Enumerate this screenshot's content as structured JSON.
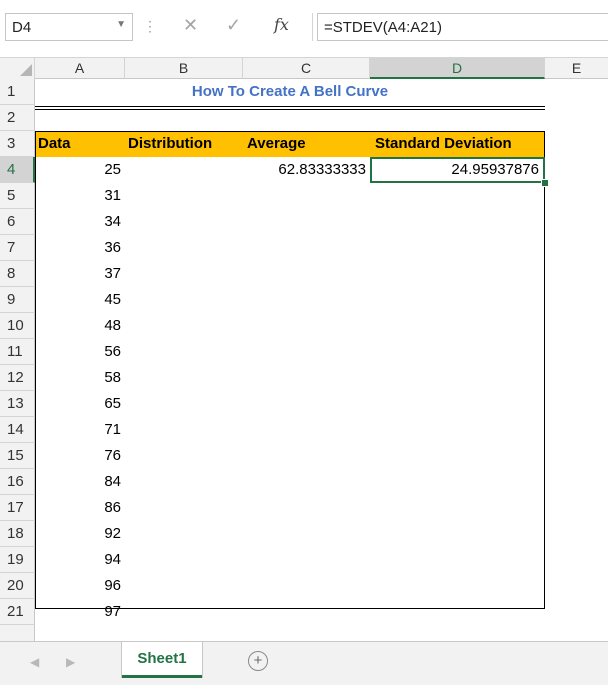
{
  "formula_bar": {
    "name_box": "D4",
    "fx_label": "fx",
    "formula": "=STDEV(A4:A21)"
  },
  "columns": [
    "A",
    "B",
    "C",
    "D",
    "E"
  ],
  "rows": [
    "1",
    "2",
    "3",
    "4",
    "5",
    "6",
    "7",
    "8",
    "9",
    "10",
    "11",
    "12",
    "13",
    "14",
    "15",
    "16",
    "17",
    "18",
    "19",
    "20",
    "21"
  ],
  "selected_column": "D",
  "selected_row": "4",
  "title": "How To Create A Bell Curve",
  "table_headers": [
    "Data",
    "Distribution",
    "Average",
    "Standard Deviation"
  ],
  "data_values": [
    "25",
    "31",
    "34",
    "36",
    "37",
    "45",
    "48",
    "56",
    "58",
    "65",
    "71",
    "76",
    "84",
    "86",
    "92",
    "94",
    "96",
    "97"
  ],
  "average": "62.83333333",
  "std_dev": "24.95937876",
  "sheet_tab": "Sheet1",
  "colors": {
    "accent": "#217346",
    "header_fill": "#ffc000",
    "title_color": "#4472c4"
  }
}
